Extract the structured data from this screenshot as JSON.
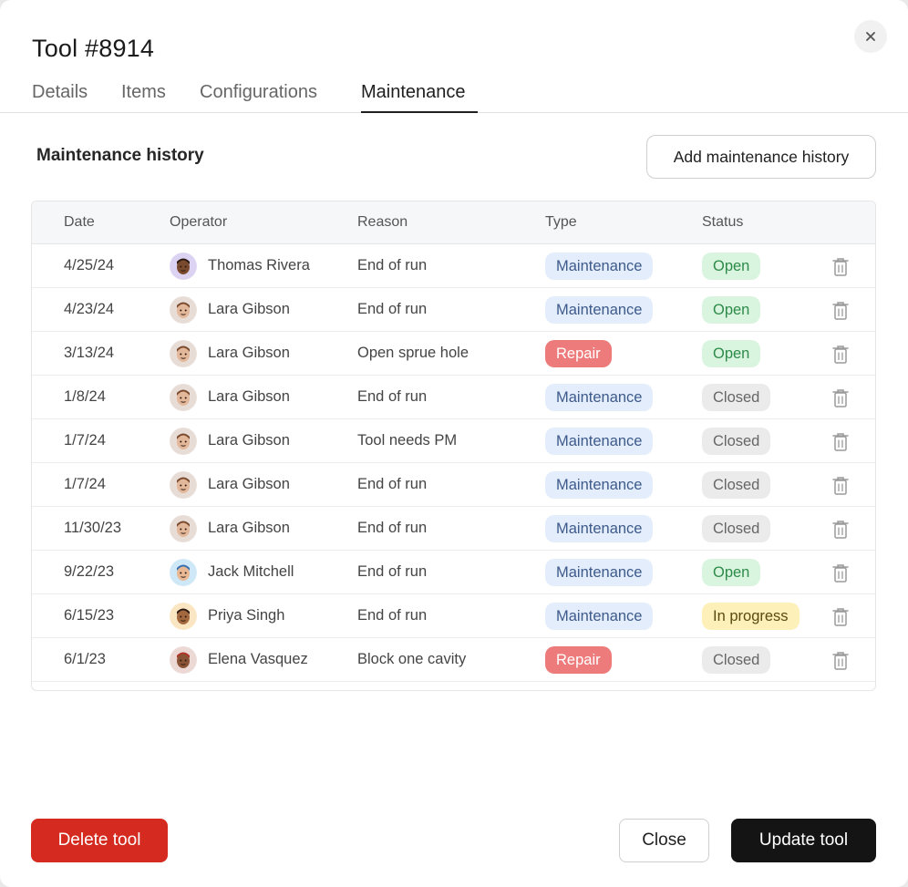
{
  "modal": {
    "title": "Tool #8914"
  },
  "tabs": [
    {
      "label": "Details"
    },
    {
      "label": "Items"
    },
    {
      "label": "Configurations"
    },
    {
      "label": "Maintenance",
      "active": true
    }
  ],
  "section": {
    "title": "Maintenance history",
    "add_label": "Add maintenance history"
  },
  "table": {
    "headers": {
      "date": "Date",
      "operator": "Operator",
      "reason": "Reason",
      "type": "Type",
      "status": "Status"
    },
    "rows": [
      {
        "date": "4/25/24",
        "operator": "Thomas Rivera",
        "avatar": "thomas",
        "reason": "End of run",
        "type": "Maintenance",
        "status": "Open"
      },
      {
        "date": "4/23/24",
        "operator": "Lara Gibson",
        "avatar": "lara",
        "reason": "End of run",
        "type": "Maintenance",
        "status": "Open"
      },
      {
        "date": "3/13/24",
        "operator": "Lara Gibson",
        "avatar": "lara",
        "reason": "Open sprue hole",
        "type": "Repair",
        "status": "Open"
      },
      {
        "date": "1/8/24",
        "operator": "Lara Gibson",
        "avatar": "lara",
        "reason": "End of run",
        "type": "Maintenance",
        "status": "Closed"
      },
      {
        "date": "1/7/24",
        "operator": "Lara Gibson",
        "avatar": "lara",
        "reason": "Tool needs PM",
        "type": "Maintenance",
        "status": "Closed"
      },
      {
        "date": "1/7/24",
        "operator": "Lara Gibson",
        "avatar": "lara",
        "reason": "End of run",
        "type": "Maintenance",
        "status": "Closed"
      },
      {
        "date": "11/30/23",
        "operator": "Lara Gibson",
        "avatar": "lara",
        "reason": "End of run",
        "type": "Maintenance",
        "status": "Closed"
      },
      {
        "date": "9/22/23",
        "operator": "Jack Mitchell",
        "avatar": "jack",
        "reason": "End of run",
        "type": "Maintenance",
        "status": "Open"
      },
      {
        "date": "6/15/23",
        "operator": "Priya Singh",
        "avatar": "priya",
        "reason": "End of run",
        "type": "Maintenance",
        "status": "In progress"
      },
      {
        "date": "6/1/23",
        "operator": "Elena Vasquez",
        "avatar": "elena",
        "reason": "Block one cavity",
        "type": "Repair",
        "status": "Closed"
      }
    ]
  },
  "footer": {
    "delete_label": "Delete tool",
    "close_label": "Close",
    "update_label": "Update tool"
  },
  "colors": {
    "delete": "#d42a1f",
    "primary": "#141414",
    "repair": "#ee7b7b",
    "maintenance_bg": "#e3edfb",
    "open_bg": "#d9f5df",
    "closed_bg": "#ebebeb",
    "in_progress_bg": "#fdf0b8"
  },
  "icons": {
    "close": "close-icon",
    "delete_row": "trash-icon"
  }
}
